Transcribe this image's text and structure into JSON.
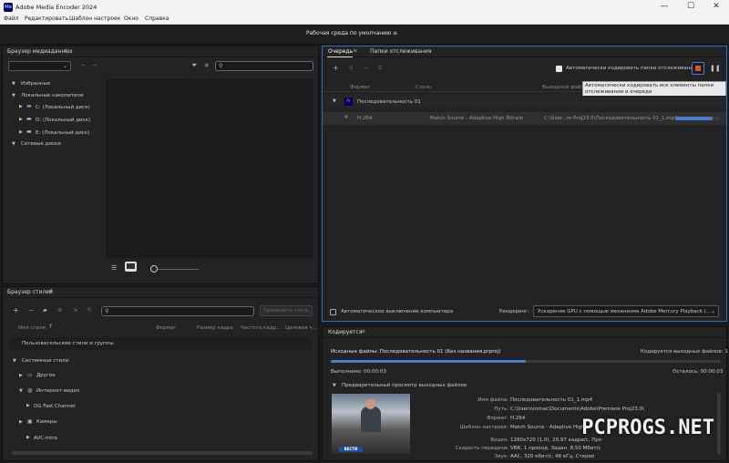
{
  "window": {
    "app_icon_text": "Me",
    "title": "Adobe Media Encoder 2024",
    "minimize": "—",
    "maximize": "☐",
    "close": "✕"
  },
  "menu": [
    "Файл",
    "Редактировать",
    "Шаблон настроек",
    "Окно",
    "Справка"
  ],
  "workspace": {
    "label": "Рабочая среда по умолчанию",
    "menu": "≡"
  },
  "media_browser": {
    "title": "Браузер медиаданных",
    "menu": "≡",
    "tree": {
      "favorites": "Избранные",
      "local": "Локальные накопители",
      "drives": [
        "C: (Локальный диск)",
        "D: (Локальный диск)",
        "E: (Локальный диск)"
      ],
      "network": "Сетевые диски"
    }
  },
  "queue": {
    "tabs": [
      "Очередь",
      "Папки отслеживания"
    ],
    "tab_menu": "≡",
    "auto_encode_label": "Автоматически кодировать папки отслеживания",
    "tooltip": "Автоматически кодировать все элементы папки отслеживания и очереди",
    "columns": {
      "format": "Формат",
      "style": "Стиль",
      "output": "Выходной файл"
    },
    "sequence": "Последовательность 01",
    "item": {
      "format": "H.264",
      "preset": "Match Source - Adaptive High Bitrate",
      "output": "C:\\User...re Proj23.0\\Последовательность 01_1.mp4",
      "progress": 0.82
    },
    "auto_shutdown": "Автоматическое выключение компьютера",
    "render_label": "Рендеринг:",
    "render_value": "Ускорение GPU с помощью механизма Adobe Mercury Playback (..."
  },
  "styles_browser": {
    "title": "Браузер стилей",
    "menu": "≡",
    "apply_button": "Применить стиль",
    "columns": {
      "name": "Имя стиля",
      "format": "Формат",
      "frame": "Размер кадра",
      "rate": "Частота кадр...",
      "bitrate": "Целевая ч..."
    },
    "user_styles": "Пользовательские стили и группы",
    "system_styles": "Системные стили",
    "items": [
      "Другое",
      "Интернет-видео",
      "DG Fast Channel",
      "Камеры",
      "AVC-Intra"
    ]
  },
  "encoding": {
    "title": "Кодируется",
    "menu": "≡",
    "source": "Исходные файлы: Последовательность 01 (Без названия.prproj)",
    "outputs": "Кодируется выходных файлов: 1",
    "elapsed": "Выполнено: 00:00:03",
    "remaining": "Осталось: 00:00:03",
    "progress": 0.5,
    "preview_label": "Предварительный просмотр выходных файлов",
    "details": [
      {
        "label": "Имя файла:",
        "value": "Последовательность 01_1.mp4"
      },
      {
        "label": "Путь:",
        "value": "C:\\Users\\romac\\Documents\\Adobe\\Premiere Proj23.0\\"
      },
      {
        "label": "Формат:",
        "value": "H.264"
      },
      {
        "label": "Шаблон настроек:",
        "value": "Match Source - Adaptive High"
      },
      {
        "label": "Видео:",
        "value": "1280x720 (1,0), 29,97 кадра/с, Про"
      },
      {
        "label": "Скорость передачи:",
        "value": "VBR, 1 проход, Задан. 8,50 Мбит/с"
      },
      {
        "label": "Звук:",
        "value": "AAC, 320 кбит/с, 48 кГц, Стерео"
      }
    ],
    "thumb_badge": "ВЕСТИ"
  },
  "watermark": "PCPROGS.NET",
  "colors": {
    "accent": "#4a7bd0",
    "stop": "#d9552c",
    "premiere": "#00005b"
  }
}
